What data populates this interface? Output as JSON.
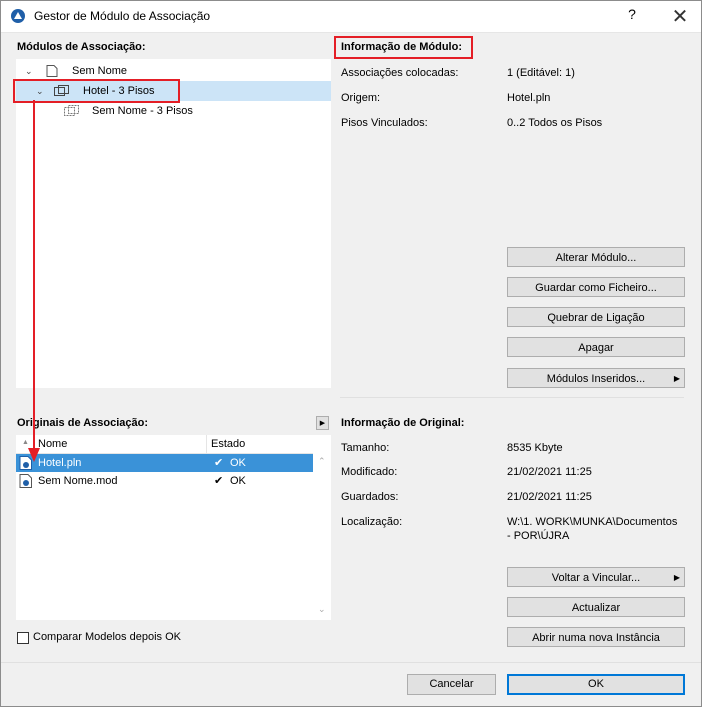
{
  "window": {
    "title": "Gestor de Módulo de Associação",
    "help": "?",
    "close": "✕"
  },
  "modules": {
    "label": "Módulos de Associação:",
    "tree": [
      {
        "label": "Sem Nome"
      },
      {
        "label": "Hotel - 3 Pisos"
      },
      {
        "label": "Sem Nome - 3 Pisos"
      }
    ]
  },
  "module_info": {
    "label": "Informação de Módulo:",
    "rows": [
      {
        "key": "Associações colocadas:",
        "value": "1 (Editável: 1)"
      },
      {
        "key": "Origem:",
        "value": "Hotel.pln"
      },
      {
        "key": "Pisos Vinculados:",
        "value": "0..2 Todos os Pisos"
      }
    ],
    "buttons": {
      "change": "Alterar Módulo...",
      "save_file": "Guardar como Ficheiro...",
      "break_link": "Quebrar de Ligação",
      "delete": "Apagar",
      "inserted": "Módulos Inseridos..."
    }
  },
  "originals": {
    "label": "Originais de Associação:",
    "columns": {
      "name": "Nome",
      "status": "Estado"
    },
    "rows": [
      {
        "name": "Hotel.pln",
        "check": "✔",
        "status": "OK"
      },
      {
        "name": "Sem Nome.mod",
        "check": "✔",
        "status": "OK"
      }
    ],
    "expand_arrow": "▶"
  },
  "original_info": {
    "label": "Informação de Original:",
    "rows": [
      {
        "key": "Tamanho:",
        "value": "8535 Kbyte"
      },
      {
        "key": "Modificado:",
        "value": "21/02/2021 11:25"
      },
      {
        "key": "Guardados:",
        "value": "21/02/2021 11:25"
      },
      {
        "key": "Localização:",
        "value": "W:\\1. WORK\\MUNKA\\Documentos",
        "value2": "- POR\\ÚJRA"
      }
    ],
    "buttons": {
      "relink": "Voltar a Vincular...",
      "update": "Actualizar",
      "open_new": "Abrir numa nova Instância"
    }
  },
  "compare": {
    "label": "Comparar Modelos depois OK",
    "checked": false
  },
  "footer": {
    "cancel": "Cancelar",
    "ok": "OK"
  },
  "colors": {
    "highlight_red": "#e41e26",
    "selection_blue": "#3a92d8",
    "selection_light": "#cce4f7"
  }
}
